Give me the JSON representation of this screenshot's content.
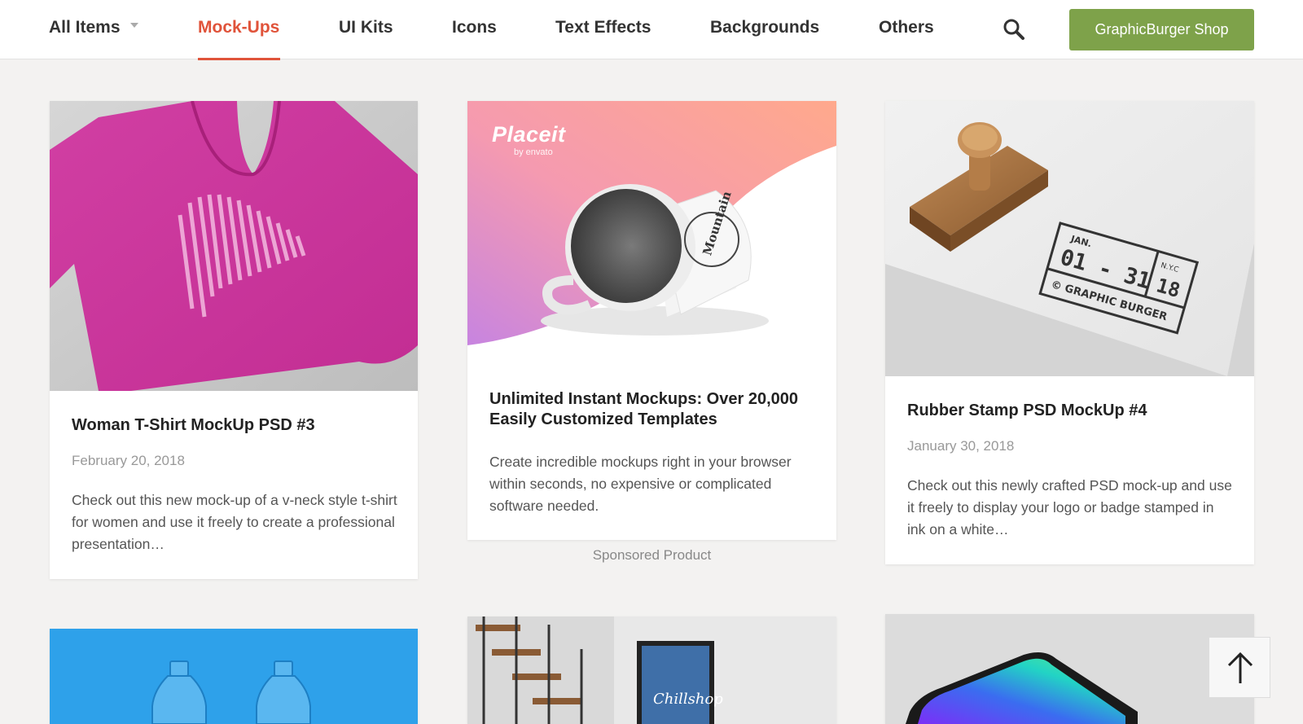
{
  "nav": {
    "items": [
      {
        "label": "All Items"
      },
      {
        "label": "Mock-Ups"
      },
      {
        "label": "UI Kits"
      },
      {
        "label": "Icons"
      },
      {
        "label": "Text Effects"
      },
      {
        "label": "Backgrounds"
      },
      {
        "label": "Others"
      }
    ],
    "active_item": "Mock-Ups",
    "search_icon": "search-icon",
    "shop_label": "GraphicBurger Shop"
  },
  "colors": {
    "accent": "#e0533a",
    "shop_button": "#7ea24a",
    "background": "#f3f2f1"
  },
  "cards": [
    {
      "title": "Woman T-Shirt MockUp PSD #3",
      "date": "February 20, 2018",
      "description": "Check out this new mock-up of a v-neck style t-shirt for women and use it freely to create a professional presentation…",
      "image": "magenta-tshirt-image"
    },
    {
      "logo": "Placeit",
      "logo_sub": "by envato",
      "title": "Unlimited Instant Mockups: Over 20,000 Easily Customized Templates",
      "description": "Create incredible mockups right in your browser within seconds, no expensive or complicated software needed.",
      "image": "mug-image",
      "mug_text": "Mountain",
      "footer": "Sponsored Product"
    },
    {
      "title": "Rubber Stamp PSD MockUp #4",
      "date": "January 30, 2018",
      "description": "Check out this newly crafted PSD mock-up and use it freely to display your logo or badge stamped in ink on a white…",
      "image": "rubber-stamp-image",
      "stamp": {
        "month": "JAN.",
        "date": "01 - 31",
        "city": "N.Y.C",
        "year": "18",
        "brand": "© GRAPHIC BURGER"
      }
    }
  ],
  "row2": [
    {
      "image": "water-bottles-image"
    },
    {
      "image": "poster-frame-image",
      "poster_text": "Chillshop"
    },
    {
      "image": "phone-image"
    }
  ],
  "scroll_top_icon": "arrow-up-icon"
}
